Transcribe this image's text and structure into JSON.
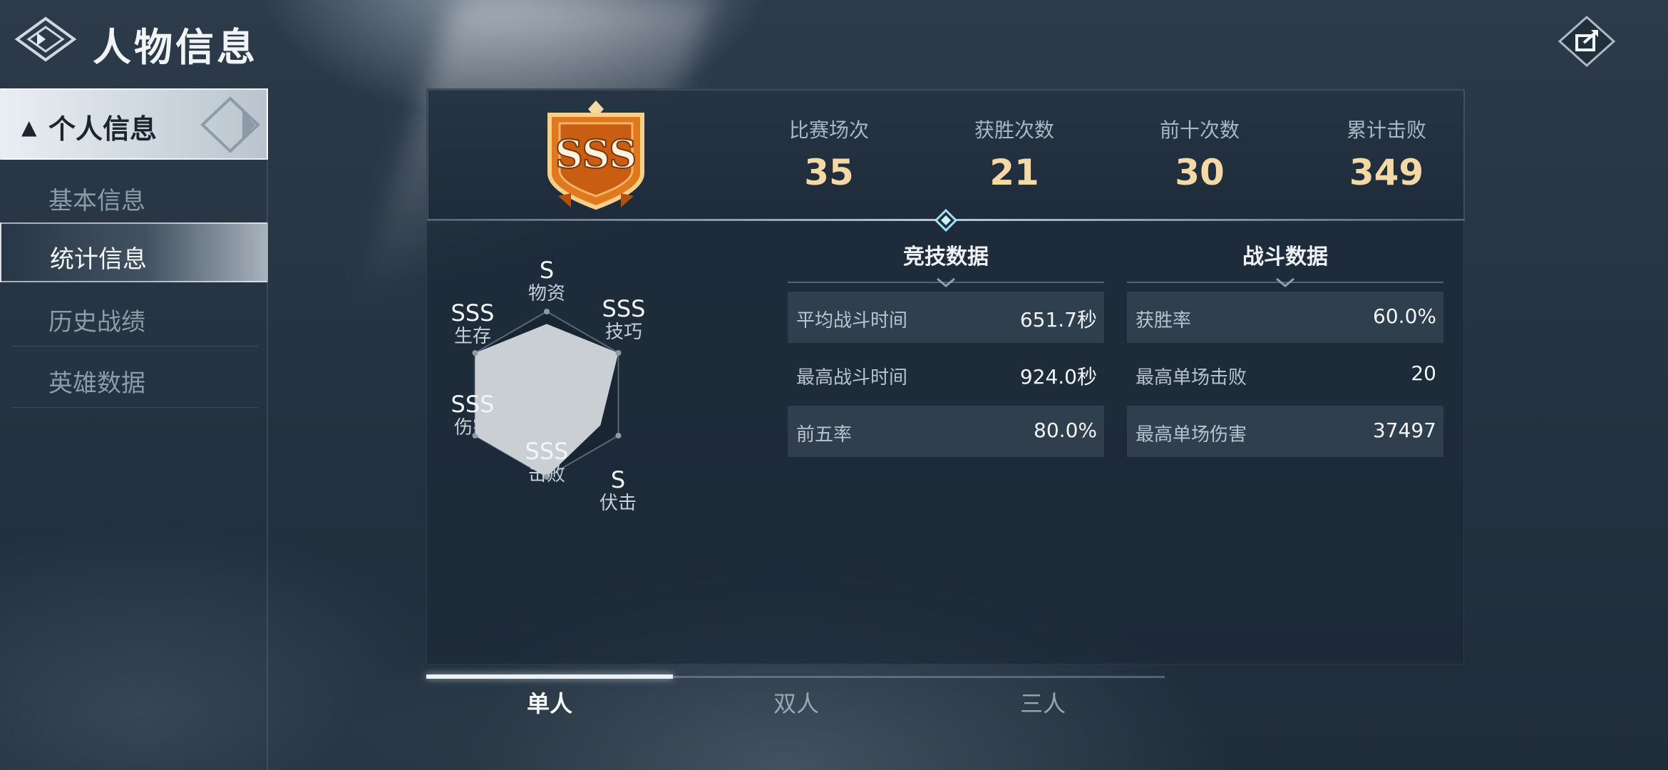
{
  "header": {
    "title": "人物信息"
  },
  "sidebar": {
    "section": {
      "label": "个人信息"
    },
    "items": [
      {
        "label": "基本信息"
      },
      {
        "label": "统计信息"
      },
      {
        "label": "历史战绩"
      },
      {
        "label": "英雄数据"
      }
    ],
    "active_item": "统计信息"
  },
  "summary": {
    "badge_text": "SSS",
    "stats": [
      {
        "label": "比赛场次",
        "value": "35"
      },
      {
        "label": "获胜次数",
        "value": "21"
      },
      {
        "label": "前十次数",
        "value": "30"
      },
      {
        "label": "累计击败",
        "value": "349"
      }
    ]
  },
  "radar": {
    "axes": [
      {
        "name": "物资",
        "grade": "S"
      },
      {
        "name": "技巧",
        "grade": "SSS"
      },
      {
        "name": "伏击",
        "grade": "S"
      },
      {
        "name": "击败",
        "grade": "SSS"
      },
      {
        "name": "伤害",
        "grade": "SSS"
      },
      {
        "name": "生存",
        "grade": "SSS"
      }
    ],
    "levels": [
      0.85,
      1.0,
      0.75,
      1.0,
      1.0,
      1.0
    ]
  },
  "competitive": {
    "title": "竞技数据",
    "rows": [
      {
        "label": "平均战斗时间",
        "value": "651.7秒"
      },
      {
        "label": "最高战斗时间",
        "value": "924.0秒"
      },
      {
        "label": "前五率",
        "value": "80.0%"
      }
    ]
  },
  "combat": {
    "title": "战斗数据",
    "rows": [
      {
        "label": "获胜率",
        "value": "60.0%"
      },
      {
        "label": "最高单场击败",
        "value": "20"
      },
      {
        "label": "最高单场伤害",
        "value": "37497"
      }
    ]
  },
  "mode_tabs": {
    "items": [
      {
        "label": "单人"
      },
      {
        "label": "双人"
      },
      {
        "label": "三人"
      }
    ],
    "active": "单人"
  },
  "colors": {
    "accent_gold": "#f4d9a6",
    "badge_orange": "#e0781e"
  }
}
